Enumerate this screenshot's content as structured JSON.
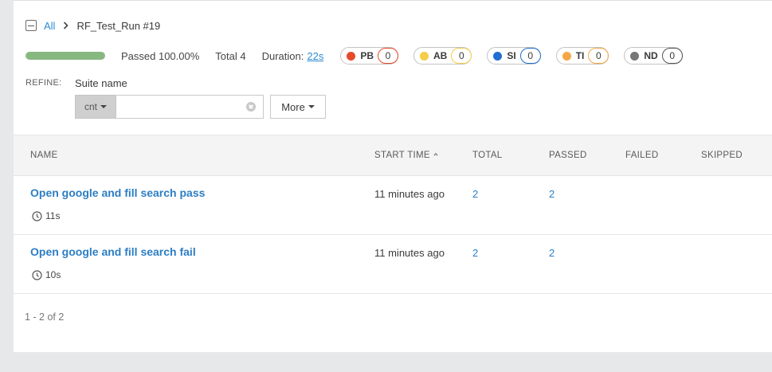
{
  "breadcrumb": {
    "all_label": "All",
    "current": "RF_Test_Run #19"
  },
  "stats": {
    "progress_fraction": 1.0,
    "passed_text": "Passed 100.00%",
    "total_text": "Total 4",
    "duration_label": "Duration:",
    "duration_value": "22s",
    "defects": [
      {
        "code": "PB",
        "count": "0",
        "color": "#e64a2b",
        "ring": "#e64a2b"
      },
      {
        "code": "AB",
        "count": "0",
        "color": "#f5cd4a",
        "ring": "#f5cd4a"
      },
      {
        "code": "SI",
        "count": "0",
        "color": "#1f6fd1",
        "ring": "#1f6fd1"
      },
      {
        "code": "TI",
        "count": "0",
        "color": "#f6a745",
        "ring": "#f6a745"
      },
      {
        "code": "ND",
        "count": "0",
        "color": "#777777",
        "ring": "#555555"
      }
    ]
  },
  "refine": {
    "label": "REFINE:",
    "field_label": "Suite name",
    "condition": "cnt",
    "value": "",
    "more_label": "More"
  },
  "table": {
    "headers": {
      "name": "NAME",
      "start_time": "START TIME",
      "total": "TOTAL",
      "passed": "PASSED",
      "failed": "FAILED",
      "skipped": "SKIPPED"
    },
    "rows": [
      {
        "name": "Open google and fill search pass",
        "duration": "11s",
        "start_time": "11 minutes ago",
        "total": "2",
        "passed": "2"
      },
      {
        "name": "Open google and fill search fail",
        "duration": "10s",
        "start_time": "11 minutes ago",
        "total": "2",
        "passed": "2"
      }
    ]
  },
  "pager": {
    "text": "1 - 2 of 2"
  },
  "colors": {
    "link": "#2c7ec4",
    "progress_fill": "#87b87f"
  }
}
